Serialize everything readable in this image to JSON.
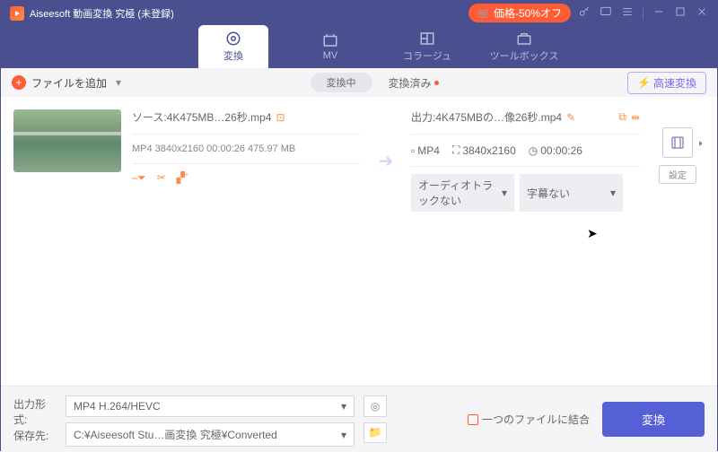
{
  "app": {
    "title": "Aiseesoft 動画変換 究極 (未登録)",
    "promo": "価格-50%オフ"
  },
  "tabs": {
    "convert": "変換",
    "mv": "MV",
    "collage": "コラージュ",
    "toolbox": "ツールボックス"
  },
  "subbar": {
    "add": "ファイルを追加",
    "converting": "変換中",
    "done": "変換済み",
    "fast": "高速変換"
  },
  "item": {
    "src_label": "ソース:4K475MB…26秒.mp4",
    "src_meta": "MP4  3840x2160  00:00:26  475.97 MB",
    "out_label": "出力:4K475MBの…像26秒.mp4",
    "out_fmt": "MP4",
    "out_res": "3840x2160",
    "out_dur": "00:00:26",
    "audio": "オーディオトラックない",
    "subtitle": "字幕ない",
    "settings": "設定"
  },
  "footer": {
    "fmt_label": "出力形式:",
    "fmt_value": "MP4 H.264/HEVC",
    "save_label": "保存先:",
    "save_value": "C:¥Aiseesoft Stu…画変換 究極¥Converted",
    "merge": "一つのファイルに結合",
    "convert": "変換"
  }
}
